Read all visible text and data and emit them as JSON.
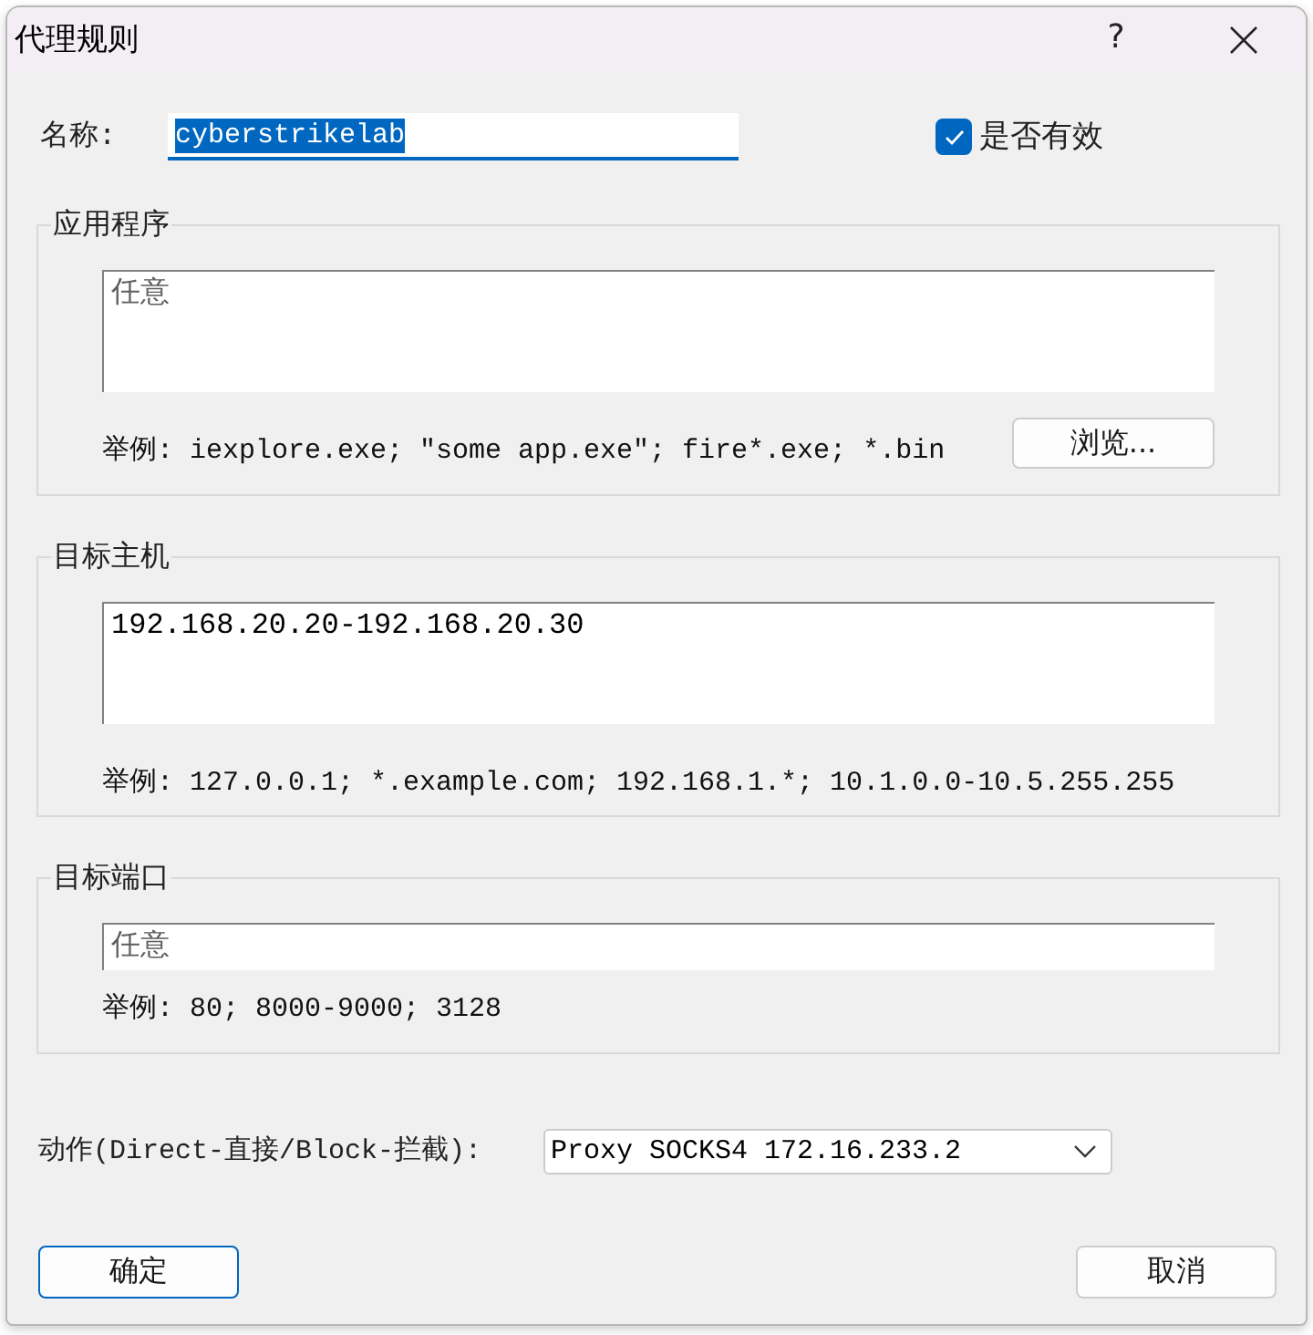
{
  "window": {
    "title": "代理规则",
    "help_button": "?"
  },
  "name_field": {
    "label": "名称:",
    "value": "cyberstrikelab",
    "focused": true
  },
  "enabled_checkbox": {
    "label": "是否有效",
    "checked": true
  },
  "groups": [
    {
      "title": "应用程序",
      "field": {
        "kind": "textarea",
        "placeholder": "任意"
      },
      "example": "举例: iexplore.exe; \"some app.exe\"; fire*.exe; *.bin",
      "button": "浏览..."
    },
    {
      "title": "目标主机",
      "field": {
        "kind": "textarea",
        "value": "192.168.20.20-192.168.20.30"
      },
      "example": "举例: 127.0.0.1; *.example.com; 192.168.1.*; 10.1.0.0-10.5.255.255"
    },
    {
      "title": "目标端口",
      "field": {
        "kind": "input",
        "placeholder": "任意"
      },
      "example": "举例: 80; 8000-9000; 3128"
    }
  ],
  "action": {
    "label": "动作(Direct-直接/Block-拦截):",
    "value": "Proxy SOCKS4 172.16.233.2"
  },
  "buttons": [
    {
      "label": "确定",
      "default": true
    },
    {
      "label": "取消",
      "default": false
    }
  ]
}
